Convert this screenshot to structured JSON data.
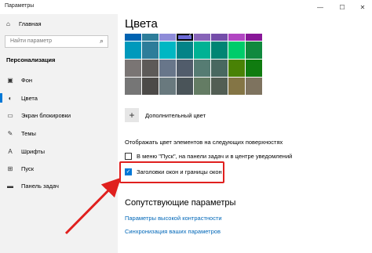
{
  "app": {
    "title": "Параметры"
  },
  "window_controls": {
    "minimize": "—",
    "maximize": "☐",
    "close": "✕"
  },
  "sidebar": {
    "home_label": "Главная",
    "search_placeholder": "Найти параметр",
    "section_title": "Персонализация",
    "items": [
      {
        "label": "Фон",
        "icon": "image-icon",
        "active": false
      },
      {
        "label": "Цвета",
        "icon": "palette-icon",
        "active": true
      },
      {
        "label": "Экран блокировки",
        "icon": "lock-screen-icon",
        "active": false
      },
      {
        "label": "Темы",
        "icon": "brush-icon",
        "active": false
      },
      {
        "label": "Шрифты",
        "icon": "font-icon",
        "active": false
      },
      {
        "label": "Пуск",
        "icon": "start-icon",
        "active": false
      },
      {
        "label": "Панель задач",
        "icon": "taskbar-icon",
        "active": false
      }
    ]
  },
  "main": {
    "title": "Цвета",
    "palette": [
      [
        "#0063b1",
        "#2d7d9a",
        "#8e8cd8",
        "#6b69d6",
        "#8764b8",
        "#744da9",
        "#b146c2",
        "#881798"
      ],
      [
        "#0099bc",
        "#2d7d9a",
        "#00b7c3",
        "#038387",
        "#00b294",
        "#018574",
        "#00cc6a",
        "#10893e"
      ],
      [
        "#7a7574",
        "#5d5a58",
        "#68768a",
        "#515c6b",
        "#567c73",
        "#486860",
        "#498205",
        "#107c10"
      ],
      [
        "#767676",
        "#4c4a48",
        "#69797e",
        "#4a5459",
        "#647c64",
        "#525e54",
        "#847545",
        "#7e735f"
      ]
    ],
    "selected_swatch": "#6b69d6",
    "custom_color_label": "Дополнительный цвет",
    "surfaces_label": "Отображать цвет элементов на следующих поверхностях",
    "checkbox_start": {
      "label": "В меню \"Пуск\", на панели задач и в центре уведомлений",
      "checked": false
    },
    "checkbox_titlebars": {
      "label": "Заголовки окон и границы окон",
      "checked": true
    },
    "related_title": "Сопутствующие параметры",
    "links": [
      "Параметры высокой контрастности",
      "Синхронизация ваших параметров"
    ]
  },
  "colors": {
    "accent": "#0078d7",
    "highlight": "#e0201e",
    "link": "#0067b8"
  }
}
